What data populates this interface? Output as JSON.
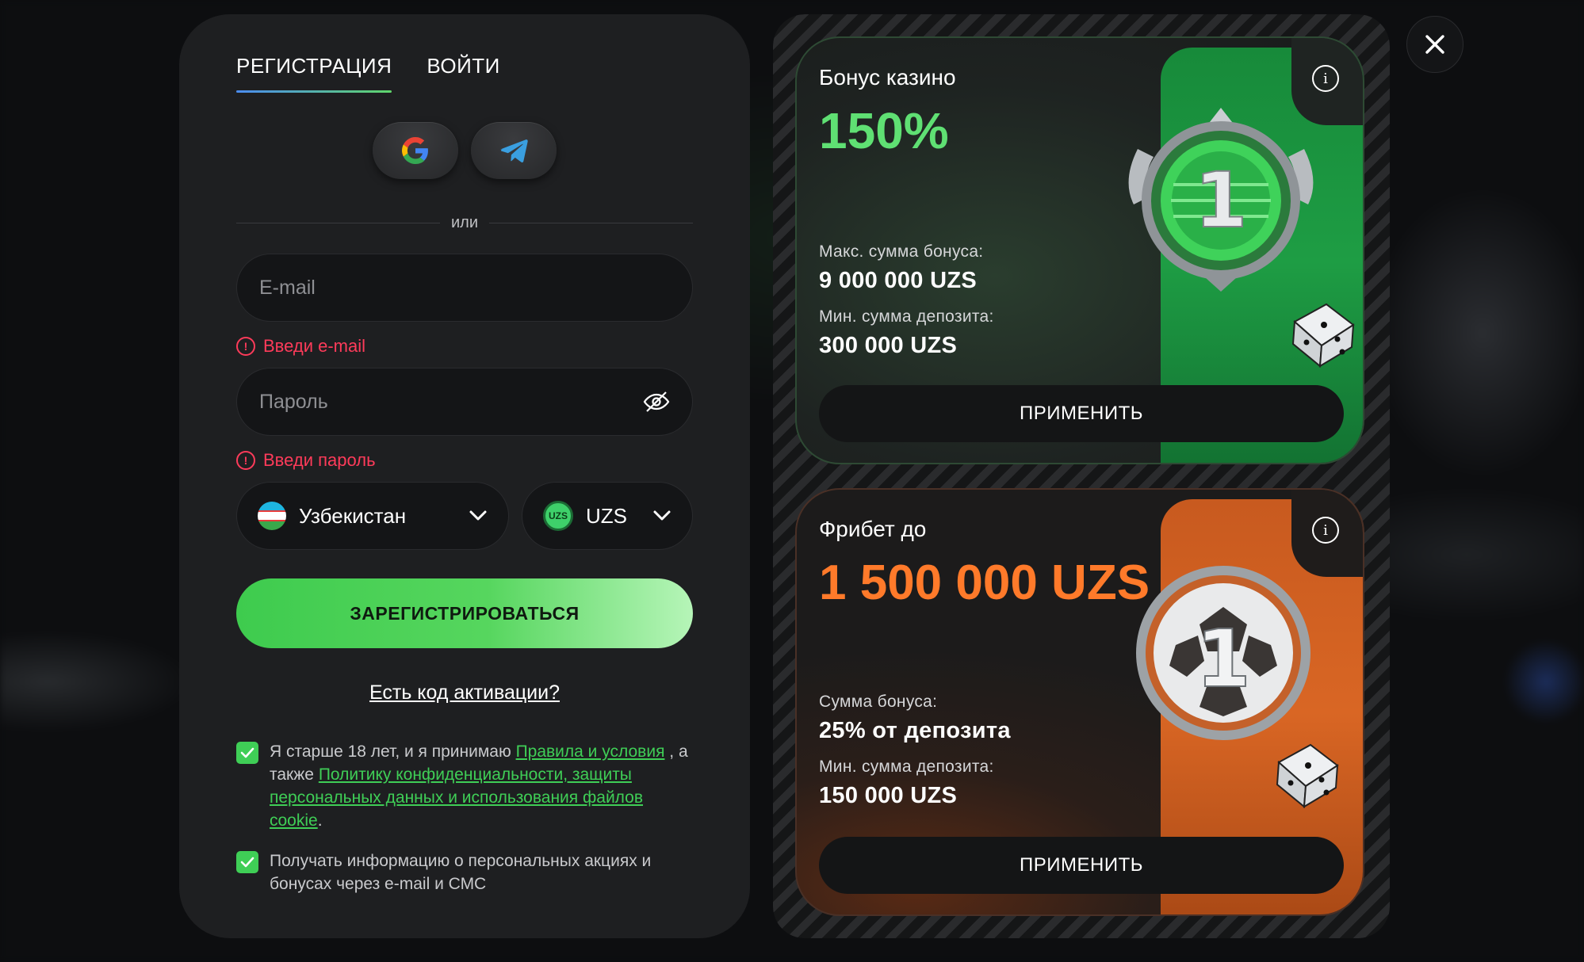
{
  "tabs": {
    "register": "РЕГИСТРАЦИЯ",
    "login": "ВОЙТИ"
  },
  "social": {
    "google_icon": "google-icon",
    "telegram_icon": "telegram-icon"
  },
  "divider_text": "или",
  "email": {
    "placeholder": "E-mail",
    "value": "",
    "error": "Введи e-mail"
  },
  "password": {
    "placeholder": "Пароль",
    "value": "",
    "error": "Введи пароль"
  },
  "country": {
    "selected": "Узбекистан"
  },
  "currency": {
    "selected": "UZS",
    "badge": "UZS"
  },
  "register_button": "ЗАРЕГИСТРИРОВАТЬСЯ",
  "activation_link": "Есть код активации?",
  "consent": {
    "age_text_1": "Я старше 18 лет, и я принимаю ",
    "rules_link": "Правила и условия",
    "age_text_2": " , а также ",
    "privacy_link": "Политику конфиденциальности, защиты персональных данных и использования файлов cookie",
    "age_text_3": ".",
    "age_checked": true,
    "promo_text": "Получать информацию о персональных акциях и бонусах через e-mail и СМС",
    "promo_checked": true
  },
  "cards": [
    {
      "title": "Бонус казино",
      "amount": "150%",
      "label_1": "Макс. сумма бонуса:",
      "value_1": "9 000 000 UZS",
      "label_2": "Мин. сумма депозита:",
      "value_2": "300 000 UZS",
      "button": "ПРИМЕНИТЬ",
      "medal_number": "1"
    },
    {
      "title": "Фрибет до",
      "amount": "1 500 000 UZS",
      "label_1": "Сумма бонуса:",
      "value_1": "25% от депозита",
      "label_2": "Мин. сумма депозита:",
      "value_2": "150 000 UZS",
      "button": "ПРИМЕНИТЬ",
      "medal_number": "1"
    }
  ],
  "colors": {
    "accent_green": "#3fce56",
    "error_red": "#ff3b5a",
    "orange": "#ff7a2a",
    "panel_bg": "#1e1f21"
  }
}
